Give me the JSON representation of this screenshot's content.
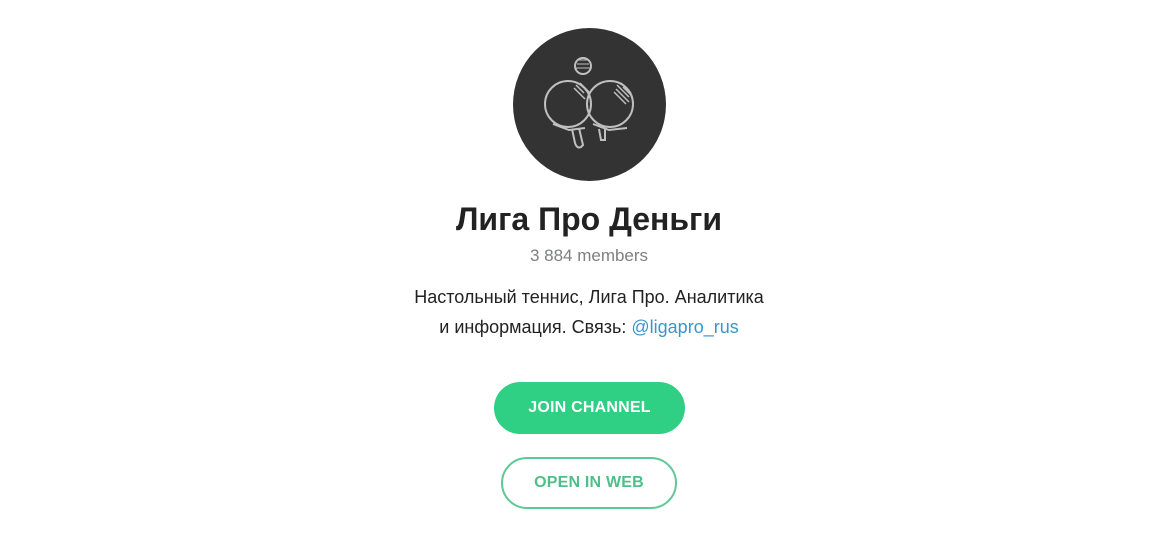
{
  "channel": {
    "avatar_icon": "ping-pong-paddles-icon",
    "title": "Лига Про Деньги",
    "members": "3 884 members",
    "description_line1": "Настольный теннис, Лига Про. Аналитика",
    "description_line2_prefix": "и информация. Связь: ",
    "contact_link": "@ligapro_rus"
  },
  "actions": {
    "join_label": "JOIN CHANNEL",
    "open_web_label": "OPEN IN WEB"
  },
  "colors": {
    "avatar_bg": "#333333",
    "join_bg": "#2fd083",
    "web_border": "#5ec996",
    "link": "#3a95cf",
    "muted_text": "#7d7f81"
  }
}
